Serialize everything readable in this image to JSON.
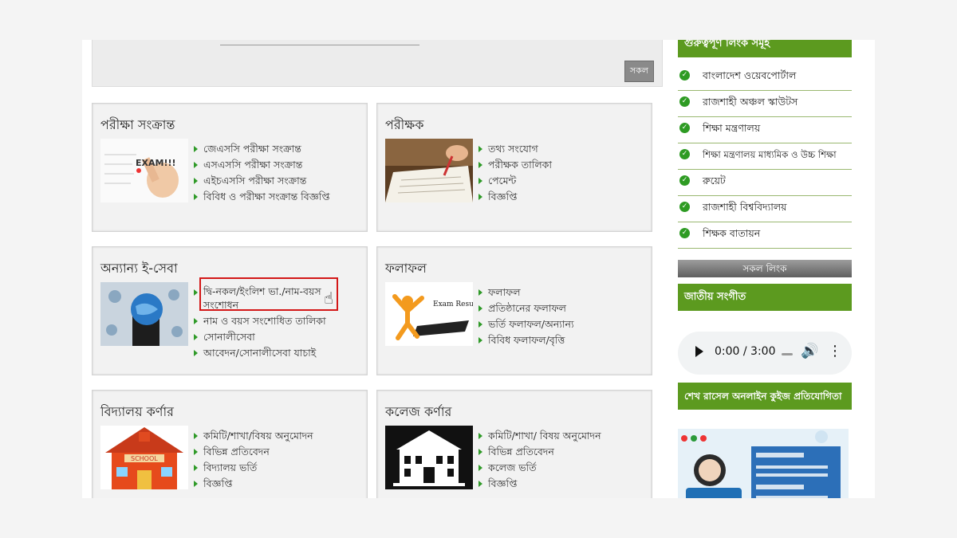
{
  "top": {
    "submit_label": "সকল"
  },
  "cards": {
    "exam": {
      "title": "পরীক্ষা সংক্রান্ত",
      "thumb_text": "EXAM!!!",
      "items": [
        "জেএসসি পরীক্ষা সংক্রান্ত",
        "এসএসসি পরীক্ষা সংক্রান্ত",
        "এইচএসসি পরীক্ষা সংক্রান্ত",
        "বিবিধ ও পরীক্ষা সংক্রান্ত বিজ্ঞপ্তি"
      ]
    },
    "examiner": {
      "title": "পরীক্ষক",
      "items": [
        "তথ্য সংযোগ",
        "পরীক্ষক তালিকা",
        "পেমেন্ট",
        "বিজ্ঞপ্তি"
      ]
    },
    "eservice": {
      "title": "অন্যান্য ই-সেবা",
      "items": [
        "দ্বি-নকল/ইংলিশ ভা./নাম-বয়স সংশোধন",
        "নাম ও বয়স সংশোধিত তালিকা",
        "সোনালীসেবা",
        "আবেদন/সোনালীসেবা যাচাই"
      ]
    },
    "results": {
      "title": "ফলাফল",
      "thumb_text": "Exam Results",
      "items": [
        "ফলাফল",
        "প্রতিষ্ঠানের ফলাফল",
        "ভর্তি ফলাফল/অন্যান্য",
        "বিবিধ ফলাফল/বৃত্তি"
      ]
    },
    "school": {
      "title": "বিদ্যালয় কর্ণার",
      "thumb_text": "SCHOOL",
      "items": [
        "কমিটি/শাখা/বিষয় অনুমোদন",
        "বিভিন্ন প্রতিবেদন",
        "বিদ্যালয় ভর্তি",
        "বিজ্ঞপ্তি"
      ]
    },
    "college": {
      "title": "কলেজ কর্ণার",
      "items": [
        "কমিটি/শাখা/ বিষয় অনুমোদন",
        "বিভিন্ন প্রতিবেদন",
        "কলেজ ভর্তি",
        "বিজ্ঞপ্তি"
      ]
    }
  },
  "sidebar": {
    "links_title": "গুরুত্বপূর্ণ লিংক সমূহ",
    "links": [
      "বাংলাদেশ ওয়েবপোর্টাল",
      "রাজশাহী অঞ্চল স্কাউটস",
      "শিক্ষা মন্ত্রণালয়",
      "শিক্ষা মন্ত্রণালয় মাধ্যমিক ও উচ্চ শিক্ষা",
      "রুয়েট",
      "রাজশাহী বিশ্ববিদ্যালয়",
      "শিক্ষক বাতায়ন"
    ],
    "all_links_label": "সকল লিংক",
    "anthem_title": "জাতীয় সংগীত",
    "audio_time": "0:00 / 3:00",
    "quiz_title": "শেখ রাসেল অনলাইন কুইজ প্রতিযোগিতা"
  },
  "colors": {
    "accent_green": "#5c9a1f",
    "highlight_red": "#d31717"
  }
}
